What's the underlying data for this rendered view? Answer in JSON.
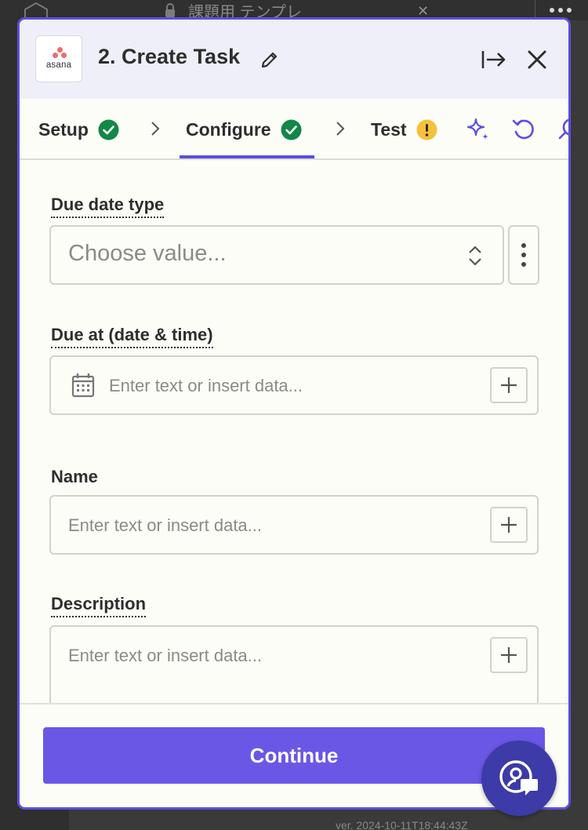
{
  "background": {
    "title": "課題用 テンプレ",
    "version_text": "ver. 2024-10-11T18:44:43Z"
  },
  "header": {
    "app_logo_text": "asana",
    "step_title": "2. Create Task"
  },
  "tabs": [
    {
      "label": "Setup",
      "status": "complete"
    },
    {
      "label": "Configure",
      "status": "complete"
    },
    {
      "label": "Test",
      "status": "warning"
    }
  ],
  "fields": {
    "due_date_type": {
      "label": "Due date type",
      "placeholder": "Choose value..."
    },
    "due_at": {
      "label": "Due at (date & time)",
      "placeholder": "Enter text or insert data..."
    },
    "name": {
      "label": "Name",
      "placeholder": "Enter text or insert data..."
    },
    "description": {
      "label": "Description",
      "placeholder": "Enter text or insert data..."
    }
  },
  "footer": {
    "continue_label": "Continue"
  },
  "colors": {
    "accent": "#5b4fe0",
    "button": "#6a57e5",
    "success": "#128746",
    "warning": "#f5c13b",
    "help_fab": "#3c3ba7"
  },
  "icons": [
    "edit-icon",
    "collapse-panel-icon",
    "close-icon",
    "check-circle-icon",
    "warning-icon",
    "ai-sparkle-icon",
    "undo-icon",
    "search-icon",
    "calendar-icon",
    "chevron-up-down-icon",
    "more-vertical-icon",
    "plus-icon",
    "help-chat-icon"
  ]
}
